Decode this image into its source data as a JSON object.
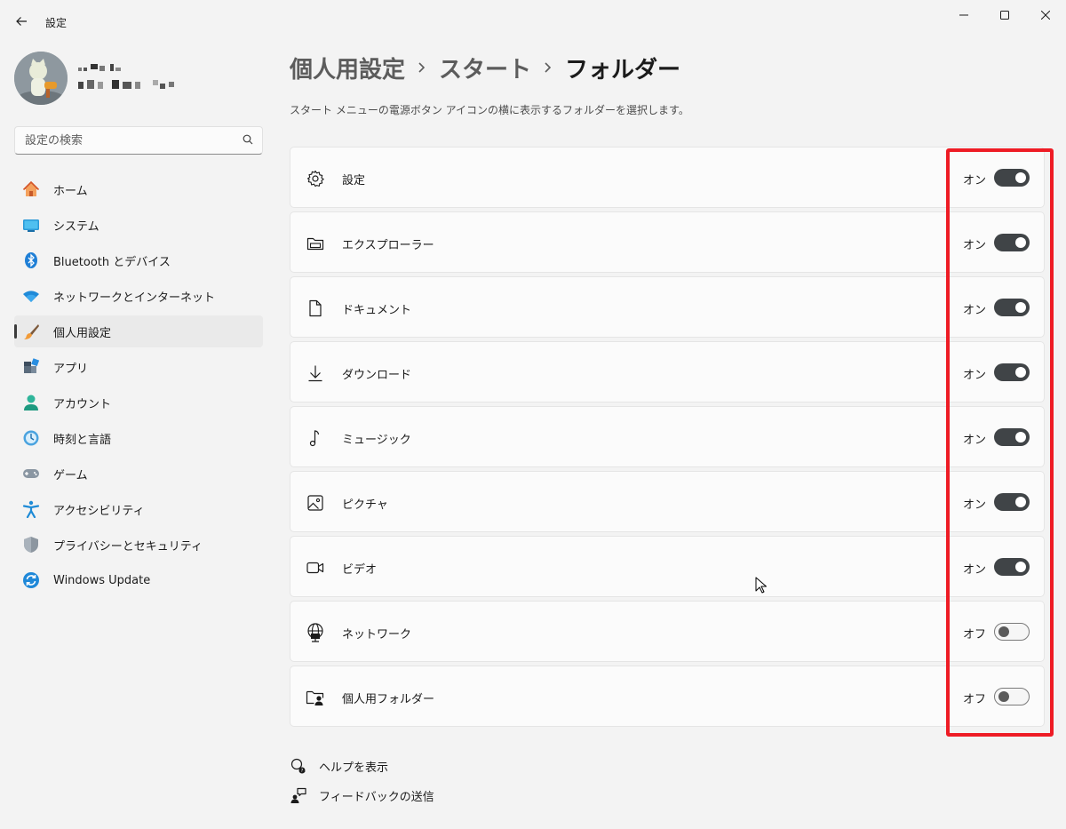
{
  "window": {
    "title": "設定",
    "controls": [
      "minimize",
      "maximize",
      "close"
    ]
  },
  "user": {
    "avatar": "cat-figure-avatar"
  },
  "search": {
    "placeholder": "設定の検索",
    "value": ""
  },
  "sidebar": {
    "items": [
      {
        "label": "ホーム",
        "icon": "home-icon",
        "active": false
      },
      {
        "label": "システム",
        "icon": "system-icon",
        "active": false
      },
      {
        "label": "Bluetooth とデバイス",
        "icon": "bluetooth-icon",
        "active": false
      },
      {
        "label": "ネットワークとインターネット",
        "icon": "wifi-icon",
        "active": false
      },
      {
        "label": "個人用設定",
        "icon": "brush-icon",
        "active": true
      },
      {
        "label": "アプリ",
        "icon": "apps-icon",
        "active": false
      },
      {
        "label": "アカウント",
        "icon": "account-icon",
        "active": false
      },
      {
        "label": "時刻と言語",
        "icon": "time-language-icon",
        "active": false
      },
      {
        "label": "ゲーム",
        "icon": "gamepad-icon",
        "active": false
      },
      {
        "label": "アクセシビリティ",
        "icon": "accessibility-icon",
        "active": false
      },
      {
        "label": "プライバシーとセキュリティ",
        "icon": "shield-icon",
        "active": false
      },
      {
        "label": "Windows Update",
        "icon": "windows-update-icon",
        "active": false
      }
    ]
  },
  "breadcrumb": [
    "個人用設定",
    "スタート",
    "フォルダー"
  ],
  "description": "スタート メニューの電源ボタン アイコンの横に表示するフォルダーを選択します。",
  "folders": [
    {
      "label": "設定",
      "icon": "gear-icon",
      "state": "オン",
      "on": true
    },
    {
      "label": "エクスプローラー",
      "icon": "file-explorer-icon",
      "state": "オン",
      "on": true
    },
    {
      "label": "ドキュメント",
      "icon": "document-icon",
      "state": "オン",
      "on": true
    },
    {
      "label": "ダウンロード",
      "icon": "download-icon",
      "state": "オン",
      "on": true
    },
    {
      "label": "ミュージック",
      "icon": "music-note-icon",
      "state": "オン",
      "on": true
    },
    {
      "label": "ピクチャ",
      "icon": "picture-icon",
      "state": "オン",
      "on": true
    },
    {
      "label": "ビデオ",
      "icon": "video-icon",
      "state": "オン",
      "on": true
    },
    {
      "label": "ネットワーク",
      "icon": "network-globe-icon",
      "state": "オフ",
      "on": false
    },
    {
      "label": "個人用フォルダー",
      "icon": "personal-folder-icon",
      "state": "オフ",
      "on": false
    }
  ],
  "footer_links": [
    {
      "label": "ヘルプを表示",
      "icon": "help-icon"
    },
    {
      "label": "フィードバックの送信",
      "icon": "feedback-icon"
    }
  ],
  "colors": {
    "highlight_box": "#ee1c25",
    "toggle_on": "#404447",
    "background": "#f3f3f3"
  }
}
